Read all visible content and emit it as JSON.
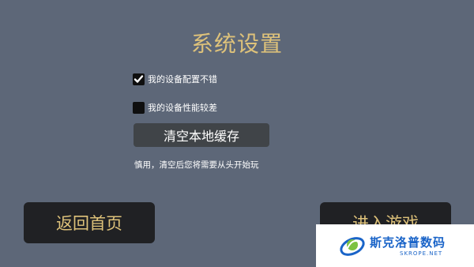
{
  "title": "系统设置",
  "options": [
    {
      "label": "我的设备配置不错",
      "checked": true
    },
    {
      "label": "我的设备性能较差",
      "checked": false
    }
  ],
  "clear_cache_label": "清空本地缓存",
  "warning_text": "慎用，清空后您将需要从头开始玩",
  "back_home_label": "返回首页",
  "enter_game_label": "进入游戏",
  "watermark": {
    "brand": "斯克洛普数码",
    "sub": "SKROPE.NET"
  },
  "colors": {
    "background": "#5d6778",
    "accent_gold": "#dec27a",
    "button_dark": "#202124",
    "button_gray": "#404448"
  }
}
